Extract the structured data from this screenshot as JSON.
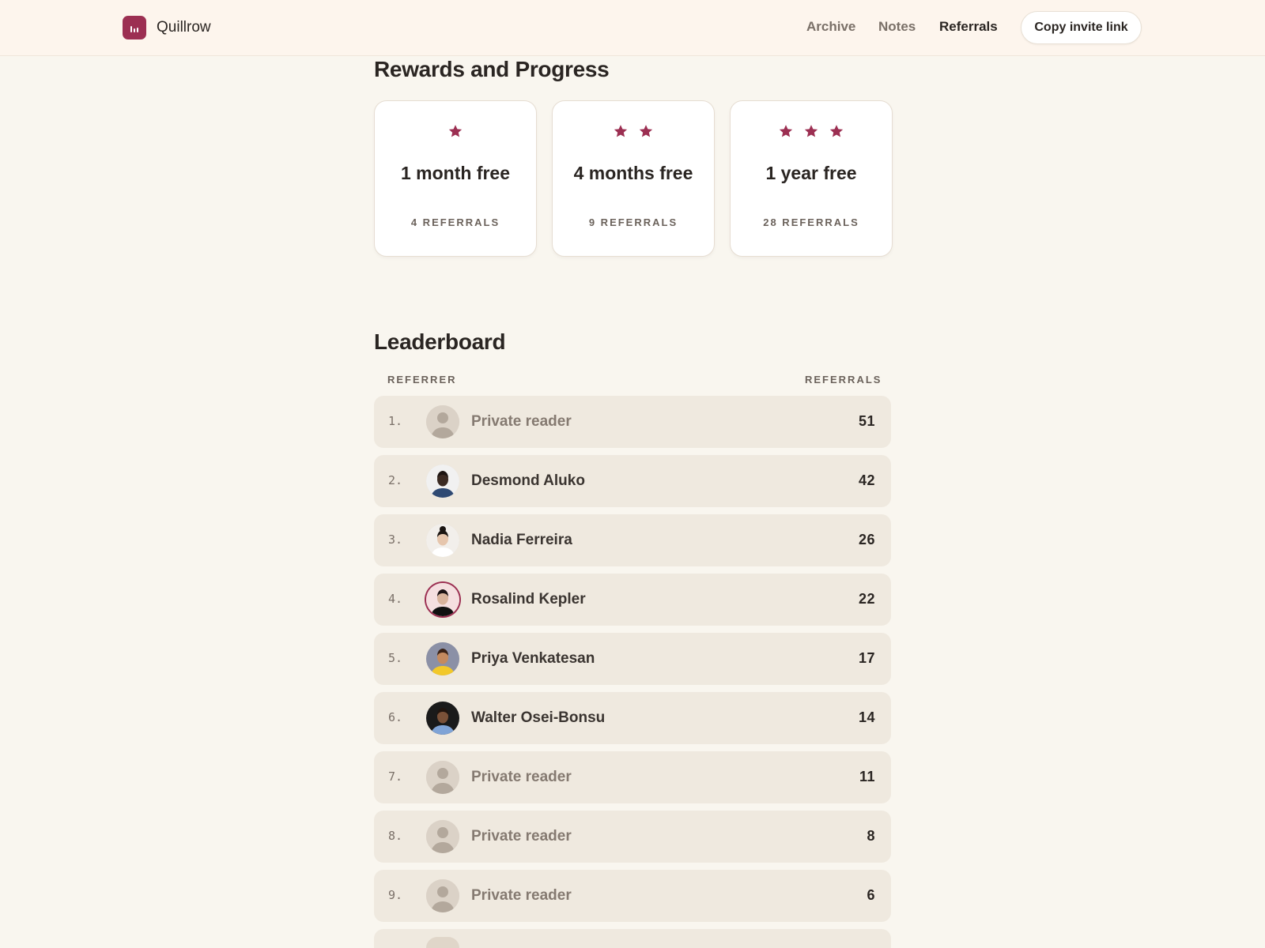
{
  "header": {
    "brand": "Quillrow",
    "nav": [
      {
        "label": "Archive",
        "active": false
      },
      {
        "label": "Notes",
        "active": false
      },
      {
        "label": "Referrals",
        "active": true
      }
    ],
    "invite_label": "Copy invite link"
  },
  "rewards": {
    "title": "Rewards and Progress",
    "cards": [
      {
        "stars": 1,
        "title": "1 month free",
        "subtitle": "4 REFERRALS"
      },
      {
        "stars": 2,
        "title": "4 months free",
        "subtitle": "9 REFERRALS"
      },
      {
        "stars": 3,
        "title": "1 year free",
        "subtitle": "28 REFERRALS"
      }
    ]
  },
  "leaderboard": {
    "title": "Leaderboard",
    "col_referrer": "REFERRER",
    "col_referrals": "REFERRALS",
    "rows": [
      {
        "rank": "1.",
        "name": "Private reader",
        "count": "51",
        "private": true,
        "avatar": "default-avatar-icon"
      },
      {
        "rank": "2.",
        "name": "Desmond Aluko",
        "count": "42",
        "private": false,
        "avatar": "photo"
      },
      {
        "rank": "3.",
        "name": "Nadia Ferreira",
        "count": "26",
        "private": false,
        "avatar": "photo"
      },
      {
        "rank": "4.",
        "name": "Rosalind Kepler",
        "count": "22",
        "private": false,
        "avatar": "photo"
      },
      {
        "rank": "5.",
        "name": "Priya Venkatesan",
        "count": "17",
        "private": false,
        "avatar": "photo"
      },
      {
        "rank": "6.",
        "name": "Walter Osei-Bonsu",
        "count": "14",
        "private": false,
        "avatar": "photo"
      },
      {
        "rank": "7.",
        "name": "Private reader",
        "count": "11",
        "private": true,
        "avatar": "default-avatar-icon"
      },
      {
        "rank": "8.",
        "name": "Private reader",
        "count": "8",
        "private": true,
        "avatar": "default-avatar-icon"
      },
      {
        "rank": "9.",
        "name": "Private reader",
        "count": "6",
        "private": true,
        "avatar": "default-avatar-icon"
      }
    ]
  },
  "colors": {
    "accent": "#9c2f52",
    "background": "#f9f6ef",
    "header_bg": "#fdf5ed",
    "row_bg": "#efe9df"
  }
}
